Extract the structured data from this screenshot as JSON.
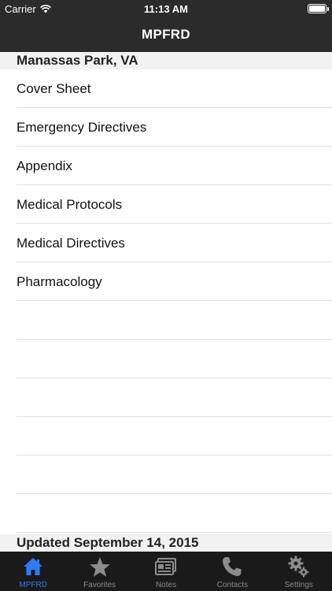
{
  "status_bar": {
    "carrier": "Carrier",
    "time": "11:13 AM"
  },
  "nav": {
    "title": "MPFRD"
  },
  "section": {
    "location": "Manassas Park, VA",
    "footer": "Updated September 14, 2015"
  },
  "list": {
    "items": [
      {
        "label": "Cover Sheet"
      },
      {
        "label": "Emergency Directives"
      },
      {
        "label": "Appendix"
      },
      {
        "label": "Medical Protocols"
      },
      {
        "label": "Medical Directives"
      },
      {
        "label": "Pharmacology"
      }
    ]
  },
  "tabs": [
    {
      "label": "MPFRD",
      "icon": "home-icon",
      "active": true
    },
    {
      "label": "Favorites",
      "icon": "star-icon",
      "active": false
    },
    {
      "label": "Notes",
      "icon": "notes-icon",
      "active": false
    },
    {
      "label": "Contacts",
      "icon": "phone-icon",
      "active": false
    },
    {
      "label": "Settings",
      "icon": "gear-icon",
      "active": false
    }
  ],
  "colors": {
    "bar_background": "#2b2b2b",
    "tab_background": "#1a1a1a",
    "accent": "#2e7cf6",
    "tab_inactive": "#8c8c8c"
  }
}
